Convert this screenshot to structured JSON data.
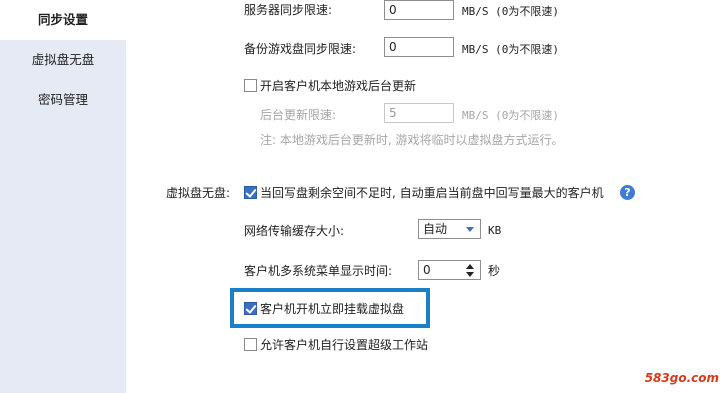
{
  "sidebar": {
    "items": [
      {
        "label": "同步设置",
        "active": true
      },
      {
        "label": "虚拟盘无盘",
        "active": false
      },
      {
        "label": "密码管理",
        "active": false
      }
    ]
  },
  "sync": {
    "server_limit_label": "服务器同步限速:",
    "server_limit_value": "0",
    "server_limit_unit": "MB/S  (0为不限速)",
    "backup_limit_label": "备份游戏盘同步限速:",
    "backup_limit_value": "0",
    "backup_limit_unit": "MB/S  (0为不限速)",
    "bg_update_checkbox_label": "开启客户机本地游戏后台更新",
    "bg_update_checked": false,
    "bg_limit_label": "后台更新限速:",
    "bg_limit_value": "5",
    "bg_limit_unit": "MB/S  (0为不限速)",
    "bg_note": "注: 本地游戏后台更新时, 游戏将临时以虚拟盘方式运行。"
  },
  "vdisk": {
    "section_label": "虚拟盘无盘:",
    "restart_checkbox_label": "当回写盘剩余空间不足时, 自动重启当前盘中回写量最大的客户机",
    "restart_checked": true,
    "help_icon": "question-icon",
    "buffer_label": "网络传输缓存大小:",
    "buffer_value": "自动",
    "buffer_unit": "KB",
    "menu_time_label": "客户机多系统菜单显示时间:",
    "menu_time_value": "0",
    "menu_time_unit": "秒",
    "mount_checkbox_label": "客户机开机立即挂载虚拟盘",
    "mount_checked": true,
    "super_checkbox_label": "允许客户机自行设置超级工作站",
    "super_checked": false
  },
  "watermark": "583go.com",
  "colors": {
    "sidebar_bg": "#e6eaf4",
    "accent": "#3b6fbf",
    "highlight_border": "#1a7fc8",
    "watermark": "#d63a1f"
  }
}
